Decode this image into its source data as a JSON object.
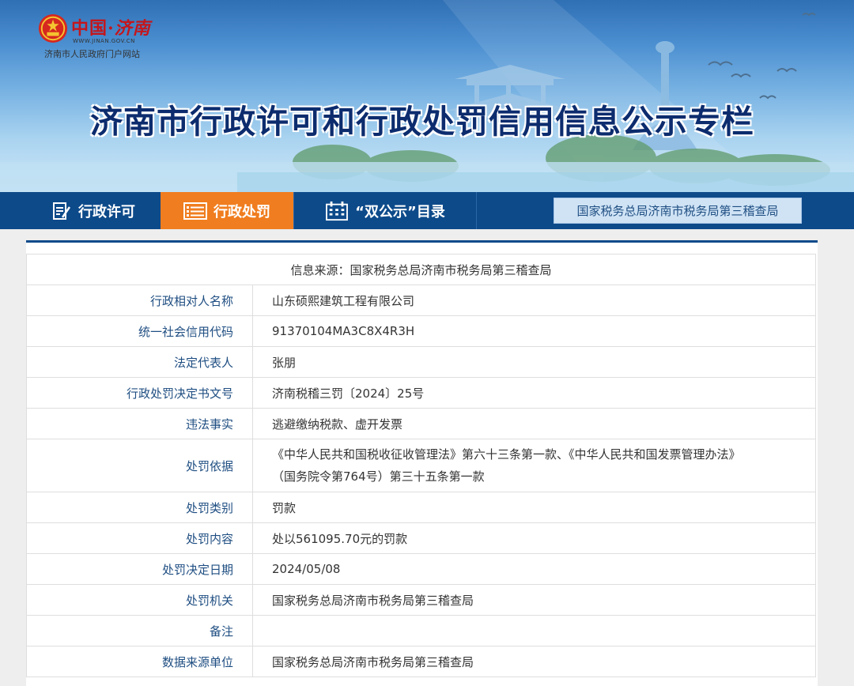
{
  "header": {
    "logo_title_part1": "中国·",
    "logo_title_part2": "济南",
    "logo_url": "WWW.JINAN.GOV.CN",
    "logo_subtitle": "济南市人民政府门户网站",
    "page_title": "济南市行政许可和行政处罚信用信息公示专栏"
  },
  "nav": {
    "items": [
      {
        "label": "行政许可",
        "icon": "document-edit-icon",
        "active": false
      },
      {
        "label": "行政处罚",
        "icon": "list-icon",
        "active": true
      },
      {
        "label": "“双公示”目录",
        "icon": "calendar-icon",
        "active": false
      }
    ],
    "department": "国家税务总局济南市税务局第三稽查局"
  },
  "colors": {
    "nav_bg": "#0d4a8a",
    "nav_active": "#f07d1f",
    "label_text": "#1f4e82"
  },
  "info": {
    "source": "信息来源：国家税务总局济南市税务局第三稽查局",
    "rows": [
      {
        "label": "行政相对人名称",
        "value": "山东硕熙建筑工程有限公司"
      },
      {
        "label": "统一社会信用代码",
        "value": "91370104MA3C8X4R3H"
      },
      {
        "label": "法定代表人",
        "value": "张朋"
      },
      {
        "label": "行政处罚决定书文号",
        "value": "济南税稽三罚〔2024〕25号"
      },
      {
        "label": "违法事实",
        "value": "逃避缴纳税款、虚开发票"
      },
      {
        "label": "处罚依据",
        "value_line1": "《中华人民共和国税收征收管理法》第六十三条第一款、《中华人民共和国发票管理办法》",
        "value_line2": "（国务院令第764号）第三十五条第一款"
      },
      {
        "label": "处罚类别",
        "value": "罚款"
      },
      {
        "label": "处罚内容",
        "value": "处以561095.70元的罚款"
      },
      {
        "label": "处罚决定日期",
        "value": "2024/05/08"
      },
      {
        "label": "处罚机关",
        "value": "国家税务总局济南市税务局第三稽查局"
      },
      {
        "label": "备注",
        "value": ""
      },
      {
        "label": "数据来源单位",
        "value": "国家税务总局济南市税务局第三稽查局"
      }
    ]
  }
}
